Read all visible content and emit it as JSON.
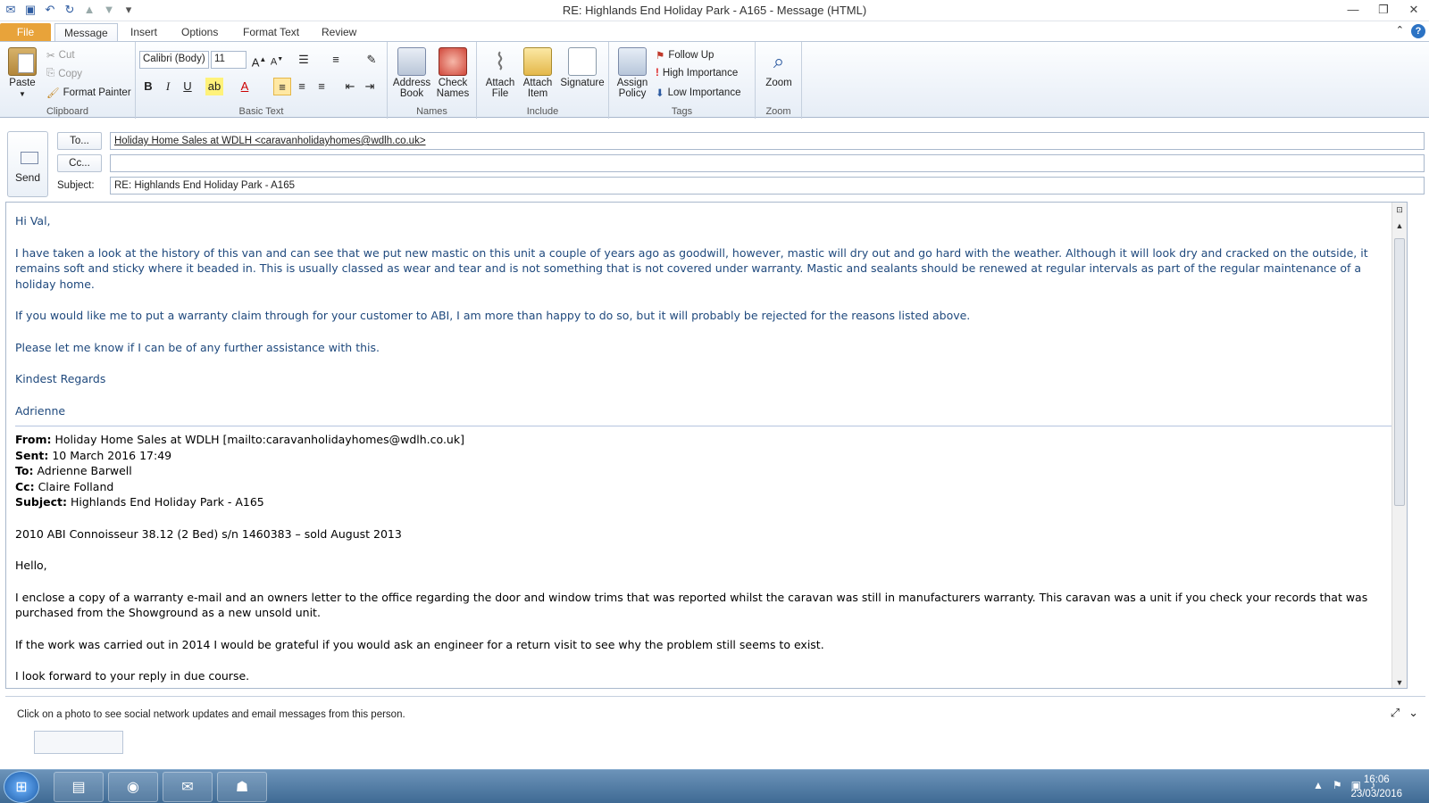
{
  "window": {
    "title": "RE: Highlands End Holiday Park - A165  -  Message (HTML)",
    "controls": [
      "—",
      "❐",
      "✕"
    ]
  },
  "qat_icons": [
    "outlook-icon",
    "save-icon",
    "undo-icon",
    "redo-icon",
    "up-icon",
    "down-icon",
    "customize-icon"
  ],
  "tabs": [
    {
      "label": "File"
    },
    {
      "label": "Message"
    },
    {
      "label": "Insert"
    },
    {
      "label": "Options"
    },
    {
      "label": "Format Text"
    },
    {
      "label": "Review"
    }
  ],
  "ribbon": {
    "clipboard": {
      "label": "Clipboard",
      "paste": "Paste",
      "cut": "Cut",
      "copy": "Copy",
      "format_painter": "Format Painter"
    },
    "basic_text": {
      "label": "Basic Text",
      "font": "Calibri (Body)",
      "size": "11"
    },
    "names": {
      "label": "Names",
      "address_book": [
        "Address",
        "Book"
      ],
      "check_names": [
        "Check",
        "Names"
      ]
    },
    "include": {
      "label": "Include",
      "attach_file": [
        "Attach",
        "File"
      ],
      "attach_item": [
        "Attach",
        "Item"
      ],
      "signature": "Signature"
    },
    "tags": {
      "label": "Tags",
      "assign_policy": [
        "Assign",
        "Policy"
      ],
      "follow_up": "Follow Up",
      "high_importance": "High Importance",
      "low_importance": "Low Importance"
    },
    "zoom": {
      "label": "Zoom",
      "zoom": "Zoom"
    }
  },
  "header": {
    "send": "Send",
    "to_button": "To...",
    "cc_button": "Cc...",
    "subject_label": "Subject:",
    "to_value": "Holiday Home Sales at WDLH <caravanholidayhomes@wdlh.co.uk>",
    "cc_value": "",
    "subject_value": "RE: Highlands End Holiday Park - A165"
  },
  "body": {
    "greeting": "Hi Val,",
    "para1": "I have taken a look at the history of this van and can see that we put new mastic on this unit a couple of years ago as goodwill, however,  mastic  will dry out and go hard with the weather.  Although it will look dry and cracked on the outside, it remains soft and sticky where it beaded in.    This is usually classed as wear and tear and is  not something that is not covered under warranty.  Mastic and sealants should be renewed at regular intervals as part of the regular maintenance of a holiday home.",
    "para2": "If you would like me to put a warranty claim through for your customer to ABI, I am more than happy to do so, but  it will probably be rejected for the reasons listed above.",
    "para3": "Please let me know if I can be of any further assistance with this.",
    "signoff": "Kindest Regards",
    "name": "Adrienne",
    "original": {
      "from_label": "From:",
      "from": "Holiday Home Sales at WDLH [mailto:caravanholidayhomes@wdlh.co.uk]",
      "sent_label": "Sent:",
      "sent": "10 March 2016 17:49",
      "to_label": "To:",
      "to": "Adrienne Barwell",
      "cc_label": "Cc:",
      "cc": "Claire Folland",
      "subject_label": "Subject:",
      "subject": "Highlands End Holiday Park - A165",
      "line1": "2010 ABI Connoisseur 38.12 (2 Bed) s/n 1460383 – sold August 2013",
      "hello": "Hello,",
      "para1": "I enclose a copy of a warranty e-mail and an owners letter to the office regarding the door and window trims that was reported whilst the caravan was still in manufacturers warranty.  This caravan was a unit if you check your records that was purchased from the Showground as a new unsold unit.",
      "para2": "If the work was carried out in 2014 I would be grateful if you would ask an engineer for a return visit to see why the problem still seems to exist.",
      "para3": "I look forward to your reply in due course."
    }
  },
  "people_pane": {
    "message": "Click on a photo to see social network updates and email messages from this person."
  },
  "taskbar": {
    "time": "16:06",
    "date": "23/03/2016"
  },
  "colors": {
    "accent_file_tab": "#e8a33a",
    "body_blue": "#1f497d",
    "taskbar": "#4f7aa4"
  }
}
